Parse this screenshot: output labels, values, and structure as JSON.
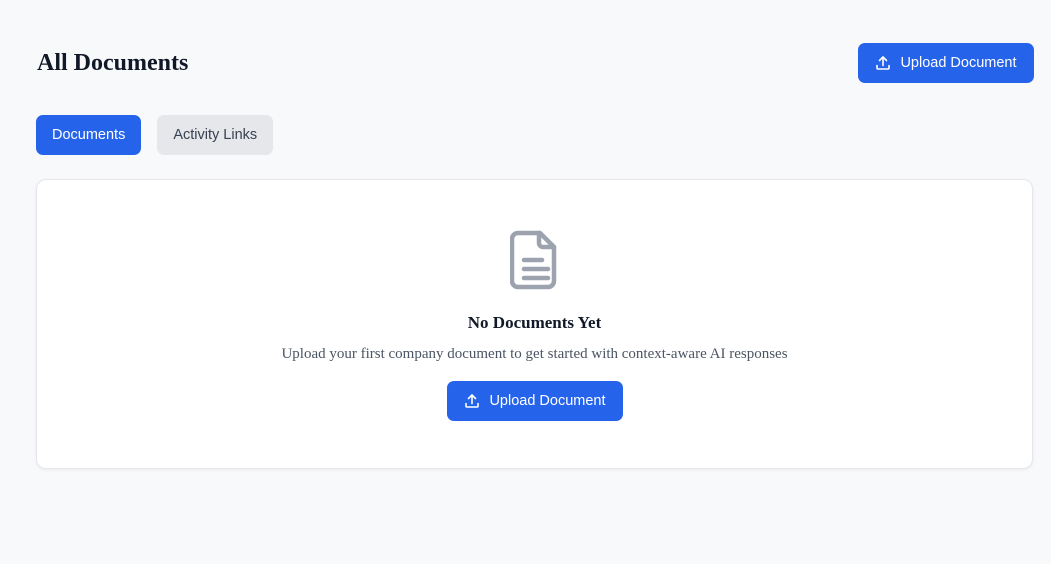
{
  "header": {
    "title": "All Documents",
    "upload_label": "Upload Document"
  },
  "tabs": [
    {
      "label": "Documents",
      "active": true
    },
    {
      "label": "Activity Links",
      "active": false
    }
  ],
  "empty_state": {
    "icon": "document-icon",
    "title": "No Documents Yet",
    "description": "Upload your first company document to get started with context-aware AI responses",
    "button_label": "Upload Document"
  },
  "colors": {
    "primary": "#2563eb",
    "background": "#f8f9fb",
    "tab_inactive": "#e5e7eb",
    "icon_gray": "#9ca3af"
  }
}
